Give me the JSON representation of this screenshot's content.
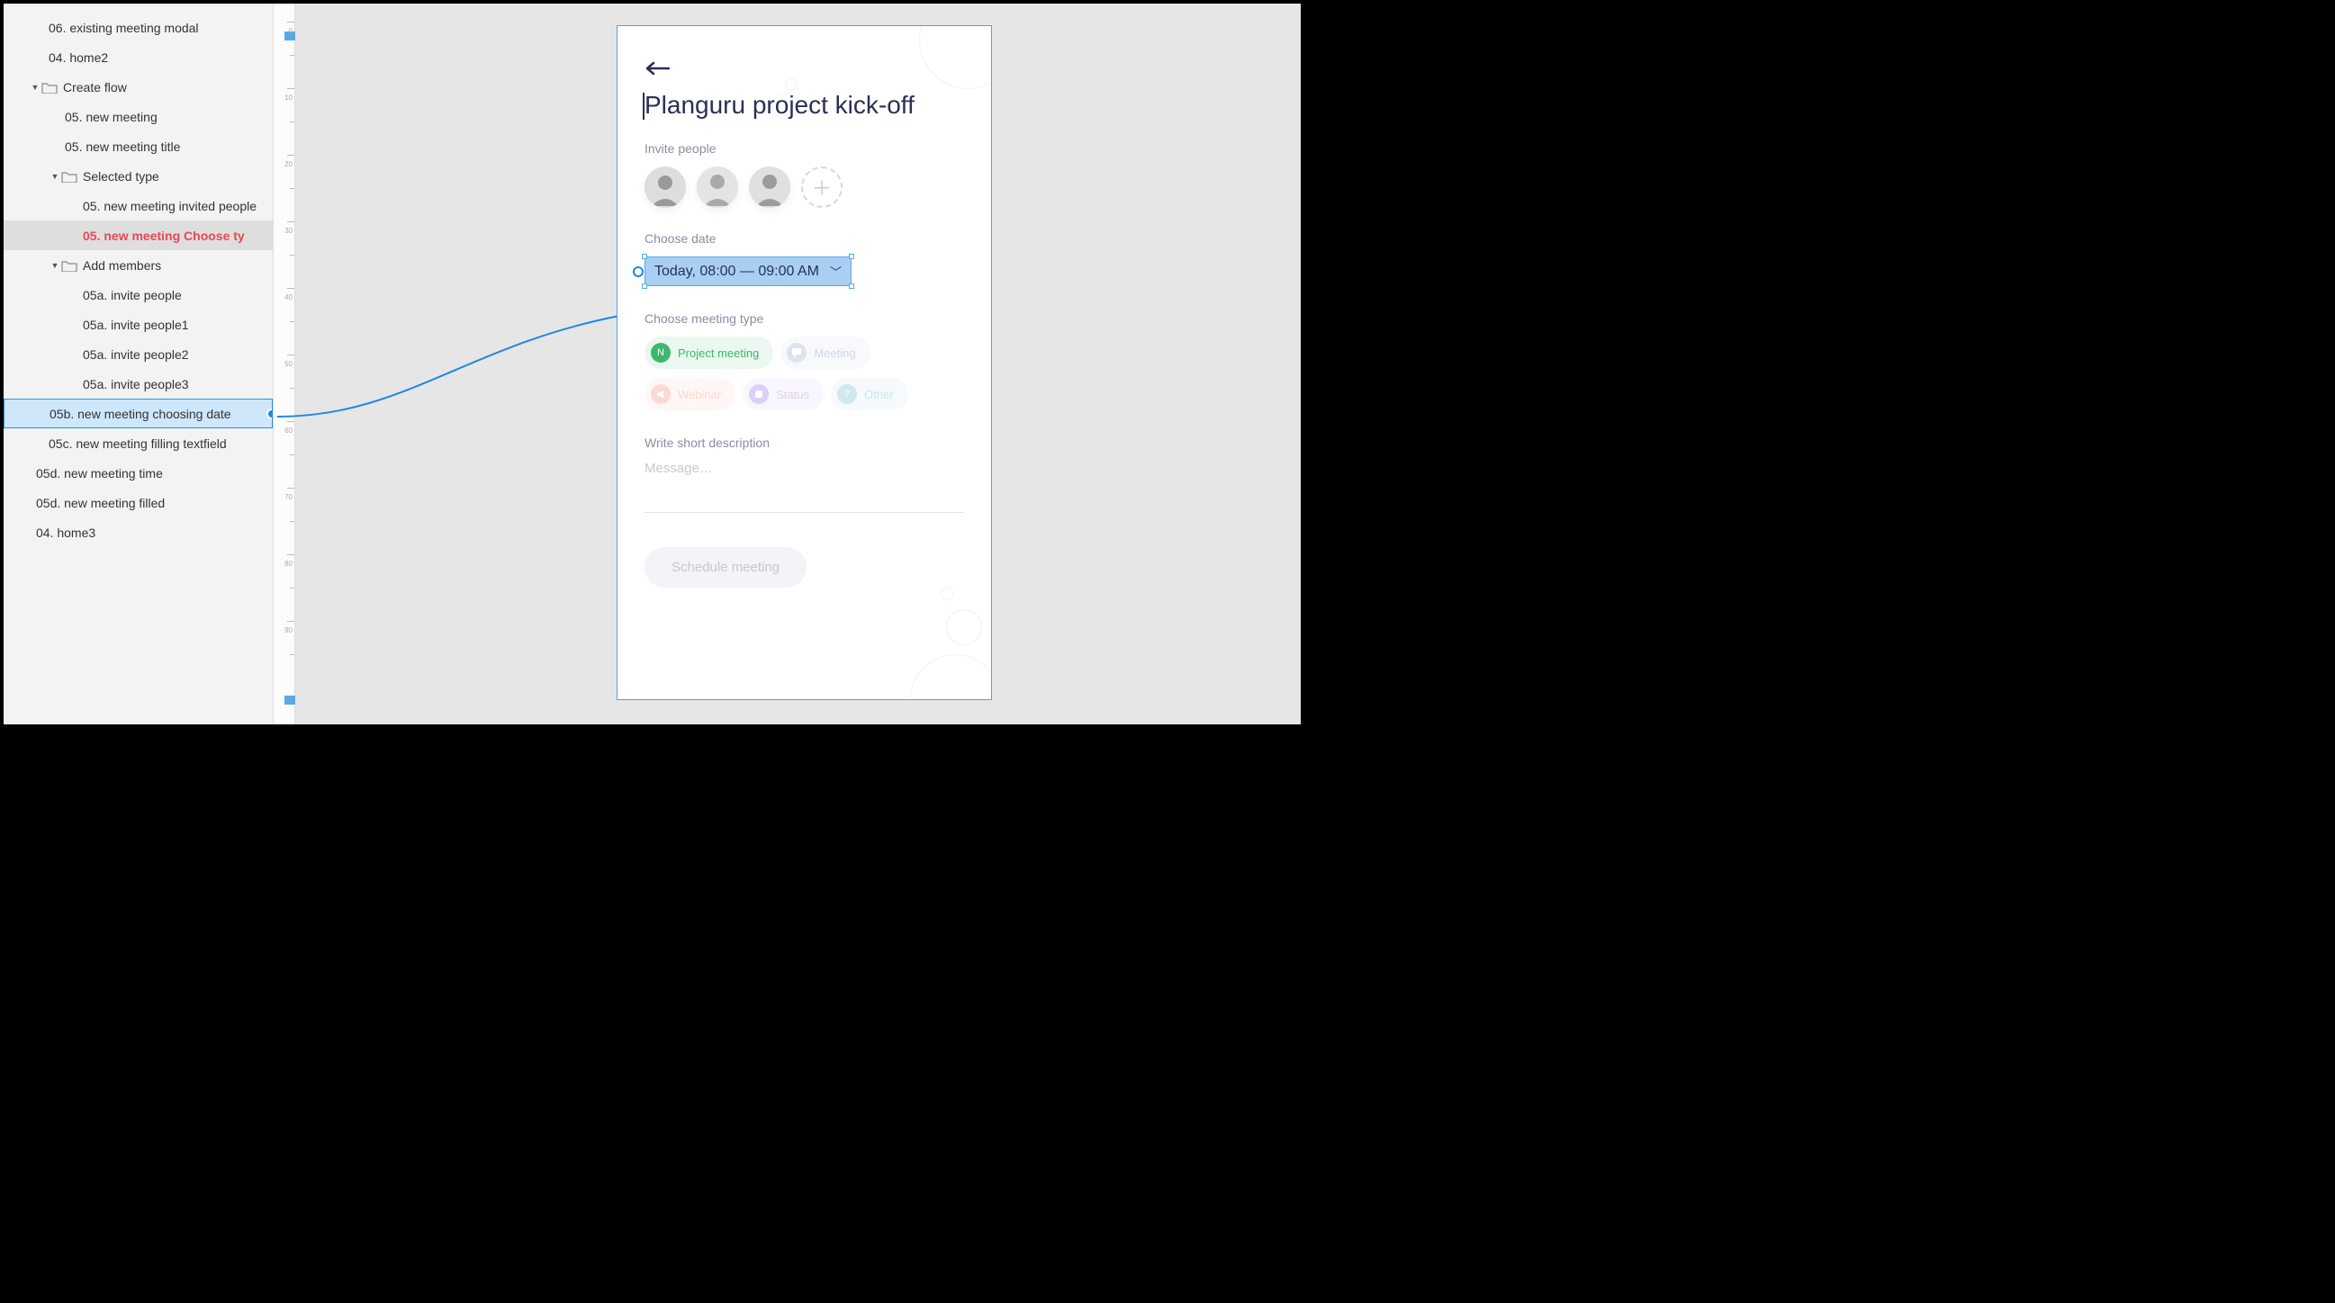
{
  "sidebar": {
    "items": [
      {
        "label": "06. existing meeting modal",
        "level": 1,
        "type": "leaf"
      },
      {
        "label": "04. home2",
        "level": 1,
        "type": "leaf"
      },
      {
        "label": "Create flow",
        "level": 0,
        "type": "folder",
        "caret": "▼"
      },
      {
        "label": "05. new meeting",
        "level": 2,
        "type": "leaf"
      },
      {
        "label": "05. new meeting title",
        "level": 2,
        "type": "leaf"
      },
      {
        "label": "Selected type",
        "level": 1,
        "type": "folder",
        "caret": "▼"
      },
      {
        "label": "05. new meeting invited people",
        "level": 3,
        "type": "leaf"
      },
      {
        "label": "05. new meeting Choose ty",
        "level": 3,
        "type": "leaf",
        "highlight": true
      },
      {
        "label": "Add members",
        "level": 1,
        "type": "folder",
        "caret": "▼"
      },
      {
        "label": "05a. invite people",
        "level": 3,
        "type": "leaf"
      },
      {
        "label": "05a. invite people1",
        "level": 3,
        "type": "leaf"
      },
      {
        "label": "05a. invite people2",
        "level": 3,
        "type": "leaf"
      },
      {
        "label": "05a. invite people3",
        "level": 3,
        "type": "leaf"
      },
      {
        "label": "05b. new meeting choosing date",
        "level": 1,
        "type": "leaf",
        "selected": true
      },
      {
        "label": "05c. new meeting filling textfield",
        "level": 1,
        "type": "leaf"
      },
      {
        "label": "05d. new meeting time",
        "level": 0,
        "type": "leaf"
      },
      {
        "label": "05d. new meeting filled",
        "level": 0,
        "type": "leaf"
      },
      {
        "label": "04. home3",
        "level": 0,
        "type": "leaf"
      }
    ]
  },
  "ruler": {
    "ticks": [
      "0",
      "10",
      "20",
      "30",
      "40",
      "50",
      "60",
      "70",
      "80",
      "90"
    ]
  },
  "artboard": {
    "title": "Planguru project kick-off",
    "invite_label": "Invite people",
    "choose_date_label": "Choose date",
    "date_value": "Today, 08:00 — 09:00 AM",
    "choose_type_label": "Choose meeting type",
    "types": {
      "project": "Project meeting",
      "meeting": "Meeting",
      "webinar": "Webinar",
      "status": "Status",
      "other": "Other"
    },
    "desc_label": "Write short description",
    "desc_placeholder": "Message…",
    "schedule_button": "Schedule meeting",
    "project_icon_letter": "N"
  }
}
